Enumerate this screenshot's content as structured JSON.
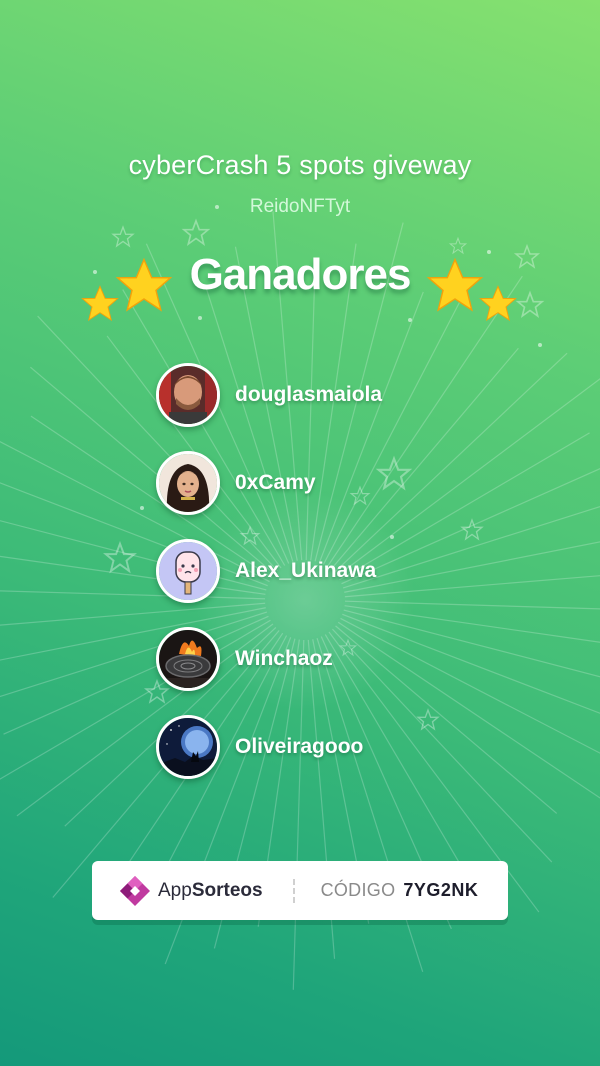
{
  "giveaway": {
    "title": "cyberCrash 5 spots giveway",
    "host": "ReidoNFTyt",
    "heading": "Ganadores"
  },
  "winners": [
    {
      "name": "douglasmaiola",
      "avatar": "avatar-man-photo"
    },
    {
      "name": "0xCamy",
      "avatar": "avatar-girl-illustration"
    },
    {
      "name": "Alex_Ukinawa",
      "avatar": "avatar-ice-cream-character"
    },
    {
      "name": "Winchaoz",
      "avatar": "avatar-fire-pan-photo"
    },
    {
      "name": "Oliveiragooo",
      "avatar": "avatar-wolf-moon-photo"
    }
  ],
  "footer": {
    "brand_prefix": "App",
    "brand_suffix": "Sorteos",
    "code_label": "CÓDIGO",
    "code_value": "7YG2NK"
  },
  "colors": {
    "background_top": "#86e16f",
    "background_bottom": "#14997a",
    "text": "#ffffff",
    "star": "#ffd21f",
    "brand": "#b5248f"
  }
}
